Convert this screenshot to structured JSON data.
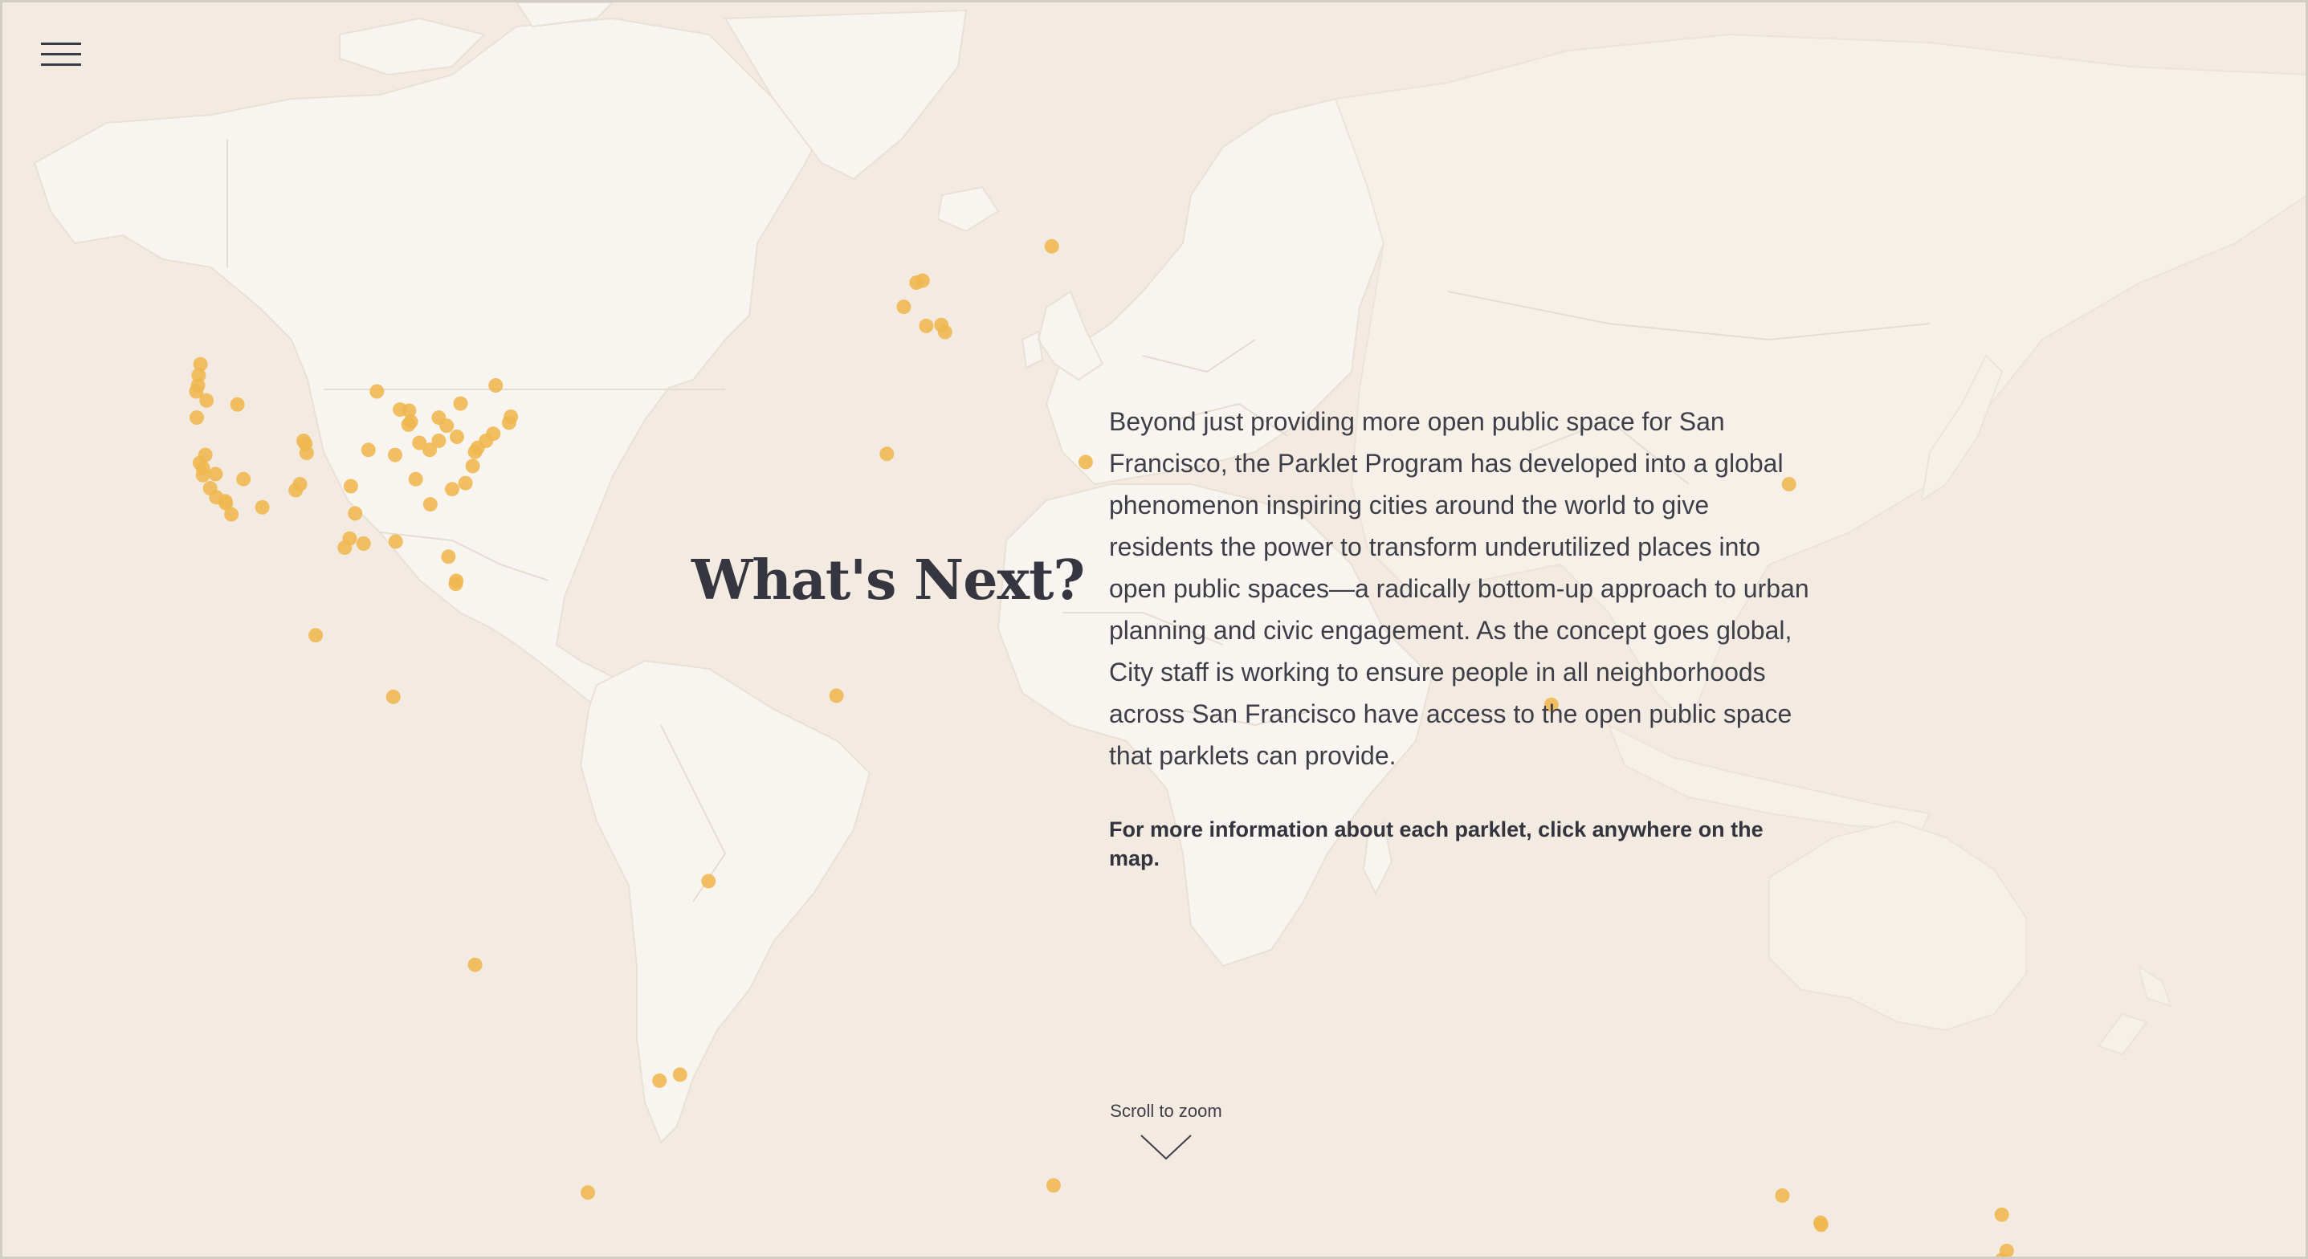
{
  "header": {
    "menu_icon": "hamburger-menu-icon"
  },
  "main": {
    "title": "What's Next?",
    "paragraph": "Beyond just providing more open public space for San Francisco, the Parklet Program has developed into a global phenomenon inspiring cities around the world to give residents the power to transform underutilized places into open public spaces—a radically bottom-up approach to urban planning and civic engagement. As the concept goes global, City staff is working to ensure people in all neighborhoods across San Francisco have access to the open public space that parklets can provide.",
    "cta": "For more information about each parklet, click anywhere on the map."
  },
  "scroll_hint": {
    "label": "Scroll to zoom",
    "icon": "chevron-down-icon"
  },
  "map": {
    "colors": {
      "ocean": "#f3ebe1",
      "land": "#f8f4ef",
      "marker": "#efb74e"
    },
    "parklet_locations": [
      {
        "lat": 47.6,
        "lon": -122.3
      },
      {
        "lat": 46.5,
        "lon": -122.6
      },
      {
        "lat": 45.5,
        "lon": -122.7
      },
      {
        "lat": 44.9,
        "lon": -123.0
      },
      {
        "lat": 44.0,
        "lon": -121.3
      },
      {
        "lat": 43.6,
        "lon": -116.2
      },
      {
        "lat": 42.3,
        "lon": -122.9
      },
      {
        "lat": 38.6,
        "lon": -121.5
      },
      {
        "lat": 37.8,
        "lon": -122.4
      },
      {
        "lat": 37.3,
        "lon": -121.9
      },
      {
        "lat": 36.6,
        "lon": -121.9
      },
      {
        "lat": 36.7,
        "lon": -119.8
      },
      {
        "lat": 35.3,
        "lon": -120.7
      },
      {
        "lat": 34.4,
        "lon": -119.7
      },
      {
        "lat": 34.0,
        "lon": -118.2
      },
      {
        "lat": 33.8,
        "lon": -118.1
      },
      {
        "lat": 32.7,
        "lon": -117.2
      },
      {
        "lat": 36.2,
        "lon": -115.2
      },
      {
        "lat": 33.4,
        "lon": -112.1
      },
      {
        "lat": 39.7,
        "lon": -105.0
      },
      {
        "lat": 40.0,
        "lon": -105.3
      },
      {
        "lat": 38.8,
        "lon": -104.8
      },
      {
        "lat": 35.1,
        "lon": -106.6
      },
      {
        "lat": 35.7,
        "lon": -105.9
      },
      {
        "lat": 44.9,
        "lon": -93.2
      },
      {
        "lat": 43.1,
        "lon": -89.4
      },
      {
        "lat": 41.9,
        "lon": -87.6
      },
      {
        "lat": 41.6,
        "lon": -88.0
      },
      {
        "lat": 42.3,
        "lon": -83.0
      },
      {
        "lat": 43.0,
        "lon": -87.9
      },
      {
        "lat": 39.1,
        "lon": -94.6
      },
      {
        "lat": 38.6,
        "lon": -90.2
      },
      {
        "lat": 39.8,
        "lon": -86.2
      },
      {
        "lat": 39.1,
        "lon": -84.5
      },
      {
        "lat": 40.0,
        "lon": -83.0
      },
      {
        "lat": 41.5,
        "lon": -81.7
      },
      {
        "lat": 40.4,
        "lon": -80.0
      },
      {
        "lat": 38.9,
        "lon": -77.0
      },
      {
        "lat": 39.3,
        "lon": -76.6
      },
      {
        "lat": 40.0,
        "lon": -75.2
      },
      {
        "lat": 40.7,
        "lon": -74.0
      },
      {
        "lat": 41.8,
        "lon": -71.4
      },
      {
        "lat": 42.4,
        "lon": -71.1
      },
      {
        "lat": 43.7,
        "lon": -79.4
      },
      {
        "lat": 45.5,
        "lon": -73.6
      },
      {
        "lat": 36.2,
        "lon": -86.8
      },
      {
        "lat": 35.2,
        "lon": -80.8
      },
      {
        "lat": 35.8,
        "lon": -78.6
      },
      {
        "lat": 37.5,
        "lon": -77.4
      },
      {
        "lat": 33.7,
        "lon": -84.4
      },
      {
        "lat": 35.5,
        "lon": -97.5
      },
      {
        "lat": 32.8,
        "lon": -96.8
      },
      {
        "lat": 30.3,
        "lon": -97.7
      },
      {
        "lat": 29.8,
        "lon": -95.4
      },
      {
        "lat": 29.4,
        "lon": -98.5
      },
      {
        "lat": 30.0,
        "lon": -90.1
      },
      {
        "lat": 28.5,
        "lon": -81.4
      },
      {
        "lat": 26.1,
        "lon": -80.1
      },
      {
        "lat": 25.8,
        "lon": -80.2
      },
      {
        "lat": 21.3,
        "lon": -157.9
      },
      {
        "lat": 20.7,
        "lon": -103.3
      },
      {
        "lat": 14.6,
        "lon": -90.5
      },
      {
        "lat": -3.7,
        "lon": -38.5
      },
      {
        "lat": -12.0,
        "lon": -77.0
      },
      {
        "lat": -22.9,
        "lon": -43.2
      },
      {
        "lat": -23.5,
        "lon": -46.6
      },
      {
        "lat": -34.6,
        "lon": -58.4
      },
      {
        "lat": 59.3,
        "lon": 18.1
      },
      {
        "lat": 55.9,
        "lon": -3.2
      },
      {
        "lat": 55.7,
        "lon": -4.2
      },
      {
        "lat": 53.3,
        "lon": -6.3
      },
      {
        "lat": 51.5,
        "lon": -0.1
      },
      {
        "lat": 51.4,
        "lon": -2.6
      },
      {
        "lat": 50.8,
        "lon": 0.5
      },
      {
        "lat": 38.7,
        "lon": -9.1
      },
      {
        "lat": 37.9,
        "lon": 23.7
      },
      {
        "lat": 14.7,
        "lon": -17.4
      },
      {
        "lat": 13.8,
        "lon": 100.5
      },
      {
        "lat": 35.7,
        "lon": 139.7
      },
      {
        "lat": -33.9,
        "lon": 18.4
      },
      {
        "lat": -34.9,
        "lon": 138.6
      },
      {
        "lat": -37.8,
        "lon": 145.0
      },
      {
        "lat": -37.6,
        "lon": 144.9
      },
      {
        "lat": -36.8,
        "lon": 174.8
      },
      {
        "lat": -41.3,
        "lon": 174.8
      },
      {
        "lat": -40.4,
        "lon": 175.6
      }
    ]
  }
}
